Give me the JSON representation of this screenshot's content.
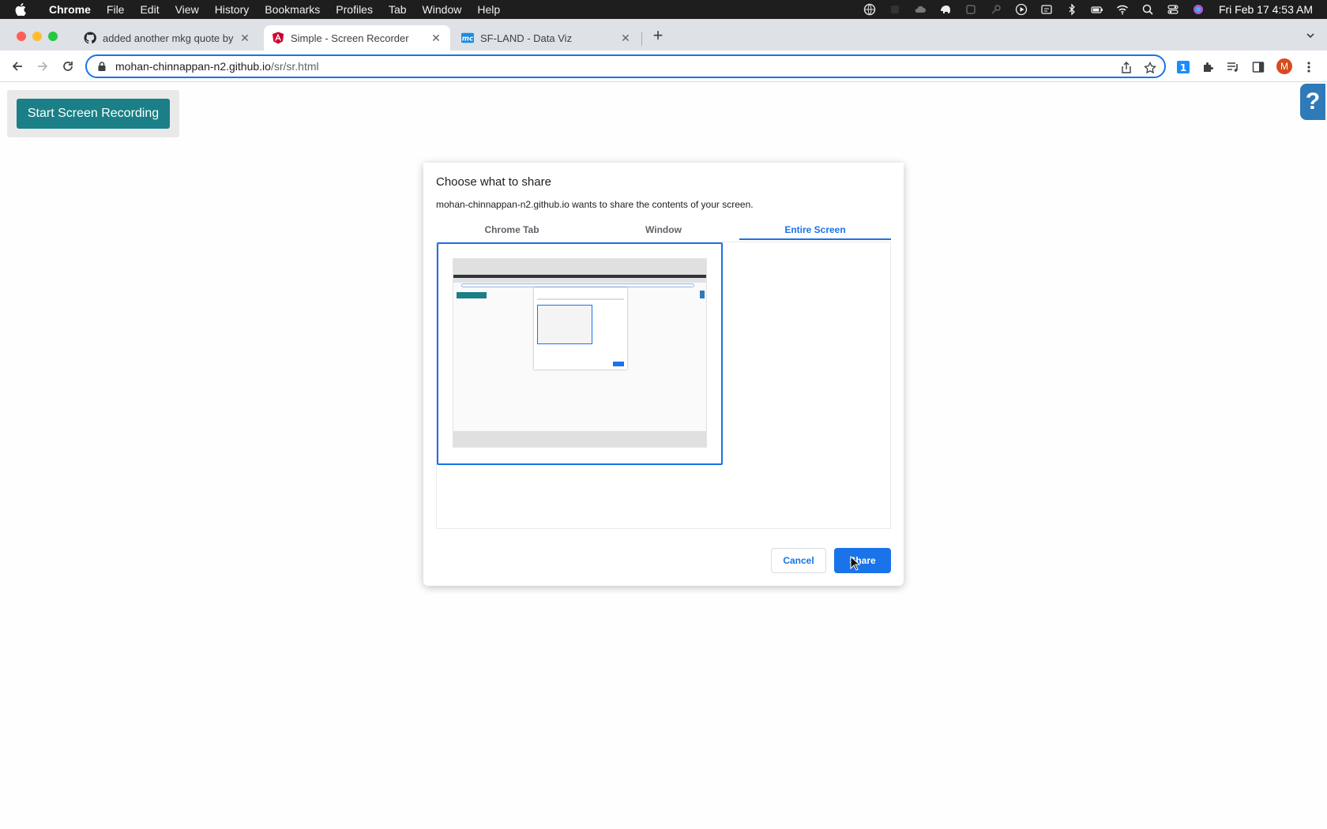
{
  "menubar": {
    "app": "Chrome",
    "items": [
      "File",
      "Edit",
      "View",
      "History",
      "Bookmarks",
      "Profiles",
      "Tab",
      "Window",
      "Help"
    ],
    "clock": "Fri Feb 17  4:53 AM"
  },
  "tabs": [
    {
      "title": "added another mkg quote by m",
      "icon": "github-icon"
    },
    {
      "title": "Simple - Screen Recorder",
      "icon": "angular-icon"
    },
    {
      "title": "SF-LAND - Data Viz",
      "icon": "mc-icon"
    }
  ],
  "omnibox": {
    "host": "mohan-chinnappan-n2.github.io",
    "path": "/sr/sr.html"
  },
  "profile_initial": "M",
  "page": {
    "record_button": "Start Screen Recording",
    "help_button": "?"
  },
  "dialog": {
    "title": "Choose what to share",
    "subtitle": "mohan-chinnappan-n2.github.io wants to share the contents of your screen.",
    "tabs": [
      "Chrome Tab",
      "Window",
      "Entire Screen"
    ],
    "active_tab": "Entire Screen",
    "cancel": "Cancel",
    "share": "Share"
  },
  "colors": {
    "accent": "#1a73e8",
    "record_button": "#1a7f86",
    "help_button": "#2f7ab8"
  }
}
